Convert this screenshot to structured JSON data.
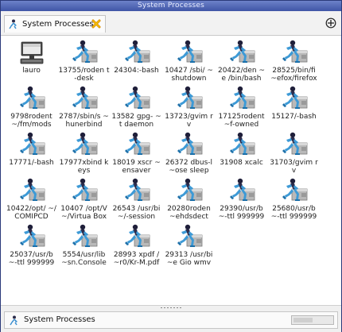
{
  "window": {
    "title": "System Processes"
  },
  "tab": {
    "label": "System Processes"
  },
  "status": {
    "label": "System Processes"
  },
  "items": [
    {
      "label": "lauro",
      "icon": "computer-icon"
    },
    {
      "label": "13755/roden t-desk",
      "icon": "process-icon"
    },
    {
      "label": "24304:-bash",
      "icon": "process-icon"
    },
    {
      "label": "10427 /sbi/ ~shutdown",
      "icon": "process-icon"
    },
    {
      "label": "20422/den ~e /bin/bash",
      "icon": "process-icon"
    },
    {
      "label": "28525/bin/fi ~efox/firefox",
      "icon": "process-icon"
    },
    {
      "label": "9798rodent ~/fm/mods",
      "icon": "process-icon"
    },
    {
      "label": "2787/sbin/s ~hunerbind",
      "icon": "process-icon"
    },
    {
      "label": "13582 gpg- ~t daemon",
      "icon": "process-icon"
    },
    {
      "label": "13723/gvim rv",
      "icon": "process-icon"
    },
    {
      "label": "17125rodent ~f-owned",
      "icon": "process-icon"
    },
    {
      "label": "15127/-bash",
      "icon": "process-icon"
    },
    {
      "label": "17771/-bash",
      "icon": "process-icon"
    },
    {
      "label": "17977xbind keys",
      "icon": "process-icon"
    },
    {
      "label": "18019 xscr ~ensaver",
      "icon": "process-icon"
    },
    {
      "label": "26372 dbus-l ~ose sleep",
      "icon": "process-icon"
    },
    {
      "label": "31908 xcalc",
      "icon": "process-icon"
    },
    {
      "label": "31703/gvim rv",
      "icon": "process-icon"
    },
    {
      "label": "10422/opt/ ~/COMIPCD",
      "icon": "process-icon"
    },
    {
      "label": "10407 /opt/V ~/Virtua Box",
      "icon": "process-icon"
    },
    {
      "label": "26543 /usr/bi ~/-session",
      "icon": "process-icon"
    },
    {
      "label": "20280roden ~ehdsdect",
      "icon": "process-icon"
    },
    {
      "label": "29390/usr/b ~-ttl 999999",
      "icon": "process-icon"
    },
    {
      "label": "25680/usr/b ~-ttl 999999",
      "icon": "process-icon"
    },
    {
      "label": "25037/usr/b ~-ttl 999999",
      "icon": "process-icon"
    },
    {
      "label": "5554/usr/lib ~sn.Console",
      "icon": "process-icon"
    },
    {
      "label": "28993 xpdf / ~r0/Kr-M.pdf",
      "icon": "process-icon"
    },
    {
      "label": "29313 /usr/bi ~e Gio wmv",
      "icon": "process-icon"
    }
  ]
}
